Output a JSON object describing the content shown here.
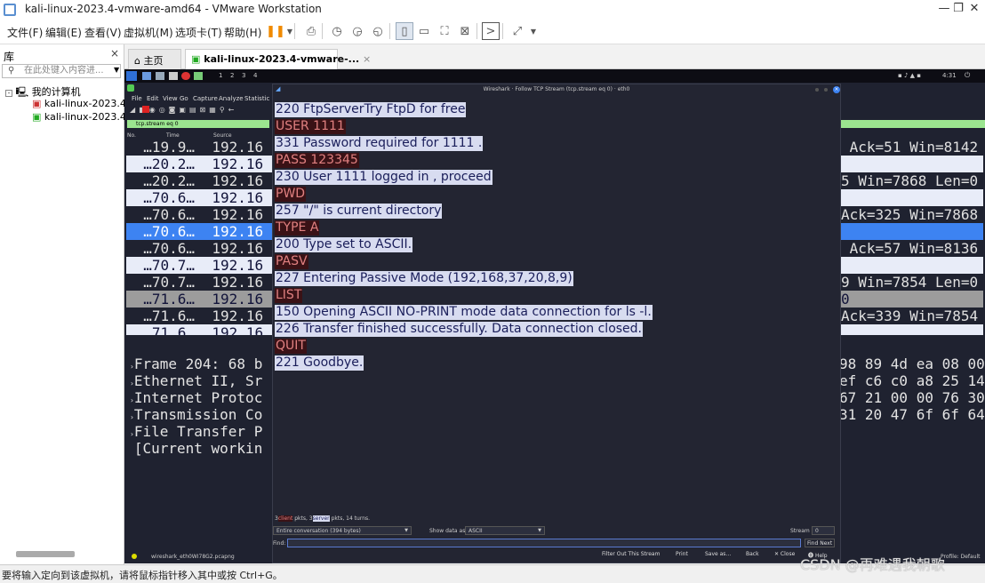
{
  "window": {
    "title": "kali-linux-2023.4-vmware-amd64 - VMware Workstation",
    "min": "—",
    "max": "❐",
    "close": "✕"
  },
  "menu": [
    "文件(F)",
    "编辑(E)",
    "查看(V)",
    "虚拟机(M)",
    "选项卡(T)",
    "帮助(H)"
  ],
  "library": {
    "header": "库",
    "close": "×",
    "search_placeholder": "在此处键入内容进...",
    "root": "我的计算机",
    "vm1": "kali-linux-2023.4-",
    "vm2": "kali-linux-2023.4-"
  },
  "tabs": {
    "home": "主页",
    "vm": "kali-linux-2023.4-vmware-...",
    "close": "×"
  },
  "kali": {
    "workspaces": [
      "1",
      "2",
      "3",
      "4"
    ],
    "clock": "4:31"
  },
  "wireshark": {
    "menu": [
      "File",
      "Edit",
      "View",
      "Go",
      "Capture",
      "Analyze",
      "Statistic"
    ],
    "filter": "tcp.stream eq 0",
    "columns": {
      "no": "No.",
      "time": "Time",
      "source": "Source"
    },
    "rows": [
      {
        "left": "  …19.9…  192.16",
        "right": " Ack=51 Win=8142"
      },
      {
        "left": "  …20.2…  192.16",
        "right": ""
      },
      {
        "left": "  …20.2…  192.16",
        "right": "5 Win=7868 Len=0"
      },
      {
        "left": "  …70.6…  192.16",
        "right": ""
      },
      {
        "left": "  …70.6…  192.16",
        "right": "Ack=325 Win=7868"
      },
      {
        "left": "  …70.6…  192.16",
        "right": ""
      },
      {
        "left": "  …70.6…  192.16",
        "right": " Ack=57 Win=8136"
      },
      {
        "left": "  …70.7…  192.16",
        "right": ""
      },
      {
        "left": "  …70.7…  192.16",
        "right": "9 Win=7854 Len=0"
      },
      {
        "left": "  …71.6…  192.16",
        "right": "0"
      },
      {
        "left": "  …71.6…  192.16",
        "right": "Ack=339 Win=7854"
      },
      {
        "left": "  …71.6…  192.16",
        "right": ""
      }
    ],
    "details": [
      "Frame 204: 68 b",
      "Ethernet II, Sr",
      "Internet Protoc",
      "Transmission Co",
      "File Transfer P",
      "[Current workin"
    ],
    "hex": [
      "98 89 4d ea 08 00",
      "ef c6 c0 a8 25 14",
      "67 21 00 00 76 30",
      "31 20 47 6f 6f 64"
    ],
    "status_file": "wireshark_eth0WI78G2.pcapng",
    "status_profile": "Profile: Default"
  },
  "dialog": {
    "title": "Wireshark · Follow TCP Stream (tcp.stream eq 0) · eth0",
    "lines": [
      {
        "t": "220 FtpServerTry FtpD for free",
        "k": "srv"
      },
      {
        "t": "USER 1111",
        "k": "cli"
      },
      {
        "t": "331 Password required for 1111 .",
        "k": "srv"
      },
      {
        "t": "PASS 123345",
        "k": "cli"
      },
      {
        "t": "230 User 1111 logged in , proceed",
        "k": "srv"
      },
      {
        "t": "PWD",
        "k": "cli"
      },
      {
        "t": "257 \"/\" is current directory",
        "k": "srv"
      },
      {
        "t": "TYPE A",
        "k": "cli"
      },
      {
        "t": "200 Type set to ASCII.",
        "k": "srv"
      },
      {
        "t": "PASV",
        "k": "cli"
      },
      {
        "t": "227 Entering Passive Mode (192,168,37,20,8,9)",
        "k": "srv"
      },
      {
        "t": "LIST",
        "k": "cli"
      },
      {
        "t": "150 Opening ASCII NO-PRINT mode data connection for ls -l.",
        "k": "srv"
      },
      {
        "t": "226 Transfer finished successfully. Data connection closed.",
        "k": "srv"
      },
      {
        "t": "QUIT",
        "k": "cli"
      },
      {
        "t": "221 Goodbye.",
        "k": "srv"
      }
    ],
    "summary": {
      "a": "3",
      "client": "client",
      "b": "pkts, 3",
      "server": "server",
      "c": "pkts, 14 turns."
    },
    "conversation": "Entire conversation (394 bytes)",
    "show_label": "Show data as",
    "show_value": "ASCII",
    "stream_label": "Stream",
    "stream_value": "0",
    "find_label": "Find:",
    "find_next": "Find Next",
    "buttons": {
      "filter_out": "Filter Out This Stream",
      "print": "Print",
      "save": "Save as…",
      "back": "Back",
      "close": "✕ Close",
      "help": "Help"
    }
  },
  "statusbar": {
    "text": "要将输入定向到该虚拟机，请将鼠标指针移入其中或按 Ctrl+G。",
    "watermark": "CSDN @再难遇我朝歌"
  }
}
